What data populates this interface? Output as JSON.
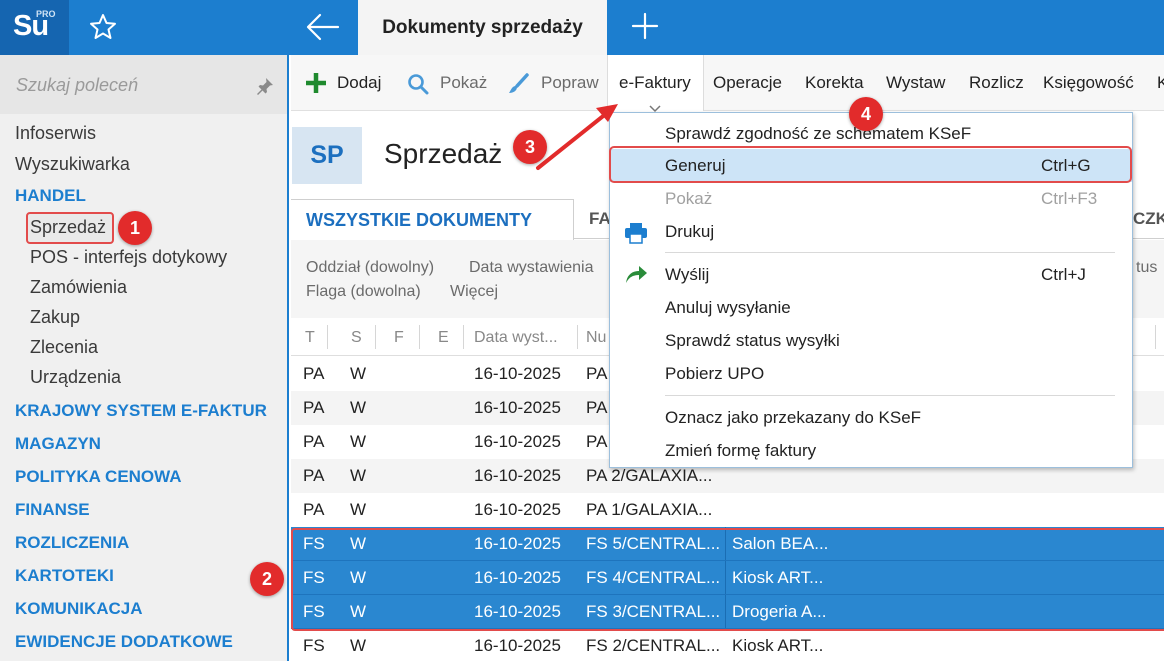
{
  "topbar": {
    "logo_main": "Su",
    "logo_pro": "PRO",
    "active_tab": "Dokumenty sprzedaży"
  },
  "sidebar": {
    "search_placeholder": "Szukaj poleceń",
    "items": [
      {
        "label": "Infoserwis",
        "kind": "item"
      },
      {
        "label": "Wyszukiwarka",
        "kind": "item"
      },
      {
        "label": "HANDEL",
        "kind": "section"
      },
      {
        "label": "Sprzedaż",
        "kind": "sub",
        "selected": true
      },
      {
        "label": "POS - interfejs dotykowy",
        "kind": "sub"
      },
      {
        "label": "Zamówienia",
        "kind": "sub"
      },
      {
        "label": "Zakup",
        "kind": "sub"
      },
      {
        "label": "Zlecenia",
        "kind": "sub"
      },
      {
        "label": "Urządzenia",
        "kind": "sub"
      },
      {
        "label": "KRAJOWY SYSTEM E-FAKTUR",
        "kind": "section"
      },
      {
        "label": "MAGAZYN",
        "kind": "section"
      },
      {
        "label": "POLITYKA CENOWA",
        "kind": "section"
      },
      {
        "label": "FINANSE",
        "kind": "section"
      },
      {
        "label": "ROZLICZENIA",
        "kind": "section"
      },
      {
        "label": "KARTOTEKI",
        "kind": "section"
      },
      {
        "label": "KOMUNIKACJA",
        "kind": "section"
      },
      {
        "label": "EWIDENCJE DODATKOWE",
        "kind": "section"
      }
    ]
  },
  "toolbar": {
    "add": "Dodaj",
    "show": "Pokaż",
    "fix": "Popraw",
    "efaktury": "e-Faktury",
    "operations": "Operacje",
    "correction": "Korekta",
    "issue": "Wystaw",
    "settle": "Rozlicz",
    "accounting": "Księgowość",
    "cut": "K"
  },
  "header": {
    "badge": "SP",
    "title": "Sprzedaż"
  },
  "doc_tabs": {
    "active": "WSZYSTKIE DOKUMENTY",
    "second": "FA",
    "right_cut": "CZK"
  },
  "filters": {
    "branch": "Oddział (dowolny)",
    "date": "Data wystawienia",
    "flag": "Flaga (dowolna)",
    "more": "Więcej",
    "status_cut": "tus"
  },
  "grid": {
    "headers": [
      "T",
      "S",
      "F",
      "E",
      "Data wyst...",
      "Nu"
    ],
    "rows": [
      {
        "t": "PA",
        "s": "W",
        "date": "16-10-2025",
        "num": "PA",
        "client": "",
        "selected": false
      },
      {
        "t": "PA",
        "s": "W",
        "date": "16-10-2025",
        "num": "PA",
        "client": "",
        "selected": false
      },
      {
        "t": "PA",
        "s": "W",
        "date": "16-10-2025",
        "num": "PA",
        "client": "",
        "selected": false
      },
      {
        "t": "PA",
        "s": "W",
        "date": "16-10-2025",
        "num": "PA 2/GALAXIA...",
        "client": "",
        "selected": false
      },
      {
        "t": "PA",
        "s": "W",
        "date": "16-10-2025",
        "num": "PA 1/GALAXIA...",
        "client": "",
        "selected": false
      },
      {
        "t": "FS",
        "s": "W",
        "date": "16-10-2025",
        "num": "FS 5/CENTRAL...",
        "client": "Salon BEA...",
        "selected": true
      },
      {
        "t": "FS",
        "s": "W",
        "date": "16-10-2025",
        "num": "FS 4/CENTRAL...",
        "client": "Kiosk ART...",
        "selected": true
      },
      {
        "t": "FS",
        "s": "W",
        "date": "16-10-2025",
        "num": "FS 3/CENTRAL...",
        "client": "Drogeria A...",
        "selected": true
      },
      {
        "t": "FS",
        "s": "W",
        "date": "16-10-2025",
        "num": "FS 2/CENTRAL...",
        "client": "Kiosk ART...",
        "selected": false
      }
    ]
  },
  "menu": {
    "items": [
      {
        "label": "Sprawdź zgodność ze schematem KSeF",
        "shortcut": ""
      },
      {
        "label": "Generuj",
        "shortcut": "Ctrl+G"
      },
      {
        "label": "Pokaż",
        "shortcut": "Ctrl+F3"
      },
      {
        "label": "Drukuj",
        "shortcut": ""
      },
      {
        "label": "Wyślij",
        "shortcut": "Ctrl+J"
      },
      {
        "label": "Anuluj wysyłanie",
        "shortcut": ""
      },
      {
        "label": "Sprawdź status wysyłki",
        "shortcut": ""
      },
      {
        "label": "Pobierz UPO",
        "shortcut": ""
      },
      {
        "label": "Oznacz jako przekazany do KSeF",
        "shortcut": ""
      },
      {
        "label": "Zmień formę faktury",
        "shortcut": ""
      }
    ]
  },
  "callouts": [
    "1",
    "2",
    "3",
    "4"
  ],
  "colors": {
    "accent": "#1c7ecf",
    "selection": "#2a87d0",
    "callout": "#e22b2b",
    "menu_highlight": "#cde4f7"
  }
}
